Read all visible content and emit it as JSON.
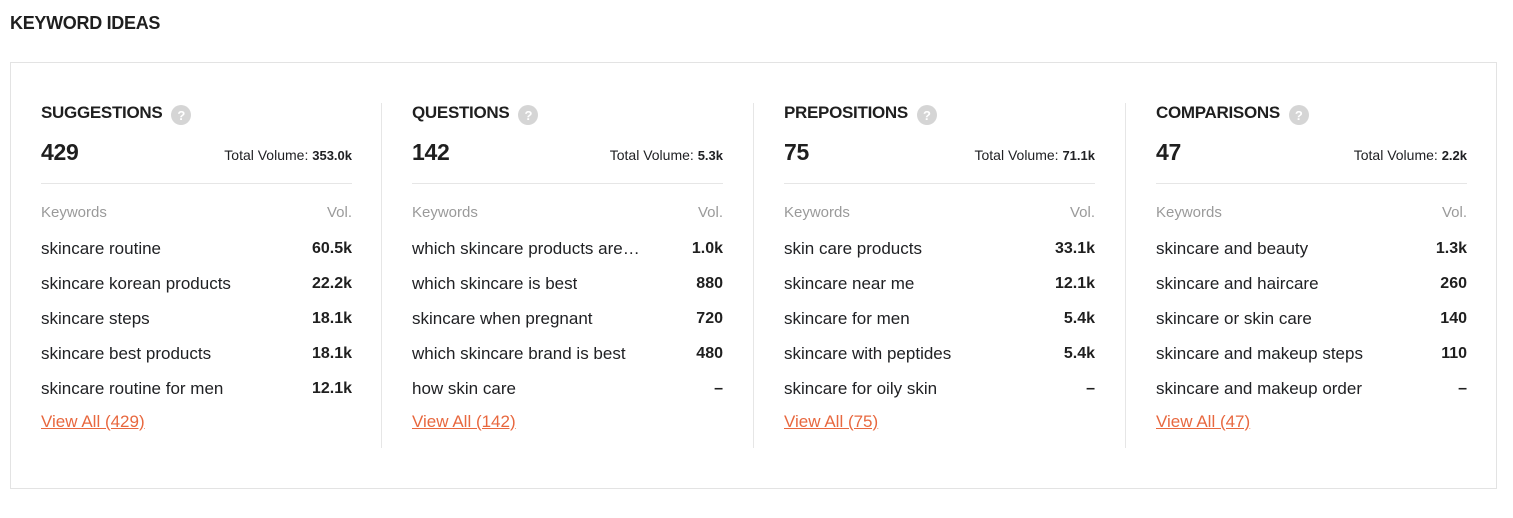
{
  "page_title": "KEYWORD IDEAS",
  "columns": [
    {
      "title": "SUGGESTIONS",
      "count": "429",
      "total_label": "Total Volume:",
      "total_value": "353.0k",
      "kw_header": "Keywords",
      "vol_header": "Vol.",
      "rows": [
        {
          "keyword": "skincare routine",
          "vol": "60.5k"
        },
        {
          "keyword": "skincare korean products",
          "vol": "22.2k"
        },
        {
          "keyword": "skincare steps",
          "vol": "18.1k"
        },
        {
          "keyword": "skincare best products",
          "vol": "18.1k"
        },
        {
          "keyword": "skincare routine for men",
          "vol": "12.1k"
        }
      ],
      "view_all": "View All (429)"
    },
    {
      "title": "QUESTIONS",
      "count": "142",
      "total_label": "Total Volume:",
      "total_value": "5.3k",
      "kw_header": "Keywords",
      "vol_header": "Vol.",
      "rows": [
        {
          "keyword": "which skincare products are…",
          "vol": "1.0k"
        },
        {
          "keyword": "which skincare is best",
          "vol": "880"
        },
        {
          "keyword": "skincare when pregnant",
          "vol": "720"
        },
        {
          "keyword": "which skincare brand is best",
          "vol": "480"
        },
        {
          "keyword": "how skin care",
          "vol": "–"
        }
      ],
      "view_all": "View All (142)"
    },
    {
      "title": "PREPOSITIONS",
      "count": "75",
      "total_label": "Total Volume:",
      "total_value": "71.1k",
      "kw_header": "Keywords",
      "vol_header": "Vol.",
      "rows": [
        {
          "keyword": "skin care products",
          "vol": "33.1k"
        },
        {
          "keyword": "skincare near me",
          "vol": "12.1k"
        },
        {
          "keyword": "skincare for men",
          "vol": "5.4k"
        },
        {
          "keyword": "skincare with peptides",
          "vol": "5.4k"
        },
        {
          "keyword": "skincare for oily skin",
          "vol": "–"
        }
      ],
      "view_all": "View All (75)"
    },
    {
      "title": "COMPARISONS",
      "count": "47",
      "total_label": "Total Volume:",
      "total_value": "2.2k",
      "kw_header": "Keywords",
      "vol_header": "Vol.",
      "rows": [
        {
          "keyword": "skincare and beauty",
          "vol": "1.3k"
        },
        {
          "keyword": "skincare and haircare",
          "vol": "260"
        },
        {
          "keyword": "skincare or skin care",
          "vol": "140"
        },
        {
          "keyword": "skincare and makeup steps",
          "vol": "110"
        },
        {
          "keyword": "skincare and makeup order",
          "vol": "–"
        }
      ],
      "view_all": "View All (47)"
    }
  ],
  "help_icon": "question-mark-icon",
  "colors": {
    "accent": "#e8683f",
    "muted": "#9a9a9a",
    "help_bg": "#d5d5d5"
  }
}
